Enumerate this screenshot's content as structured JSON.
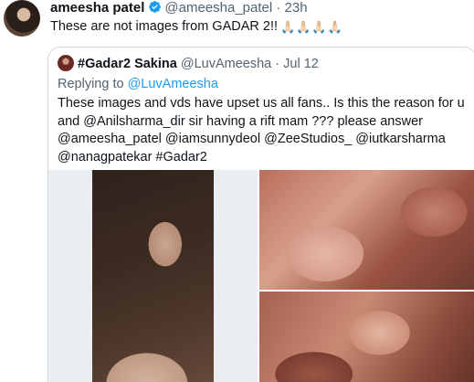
{
  "tweet": {
    "display_name": "ameesha patel",
    "handle": "@ameesha_patel",
    "separator": "·",
    "time": "23h",
    "text": "These are not images from GADAR 2!!",
    "emoji_icon": "folded-hands-icon"
  },
  "quote": {
    "display_name": "#Gadar2 Sakina",
    "handle": "@LuvAmeesha",
    "separator": "·",
    "time": "Jul 12",
    "replying_prefix": "Replying to",
    "replying_to": "@LuvAmeesha",
    "body": "These images and vds have upset us all fans.. Is this the reason for u and @Anilsharma_dir sir having a rift mam ??? please answer @ameesha_patel @iamsunnydeol @ZeeStudios_ @iutkarsharma @nanagpatekar #Gadar2"
  },
  "colors": {
    "verified": "#1d9bf0",
    "mention": "#1d9bf0",
    "secondary_text": "#536471",
    "card_border": "#cfd9de"
  }
}
